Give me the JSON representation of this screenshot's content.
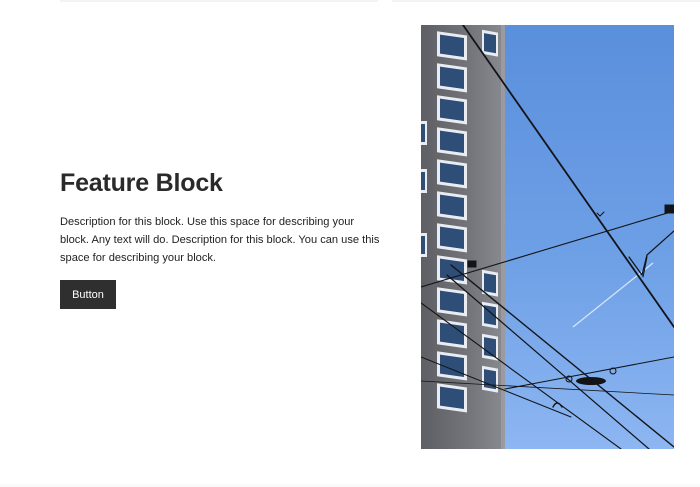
{
  "feature": {
    "title": "Feature Block",
    "description": "Description for this block. Use this space for describing your block. Any text will do. Description for this block. You can use this space for describing your block.",
    "button_label": "Button"
  },
  "image": {
    "subject": "building-and-tram-wires-photo"
  },
  "colors": {
    "sky_top": "#5a8fdc",
    "sky_bottom": "#8db6f2",
    "building": "#6c6d72",
    "window_frame": "#e9ecf0",
    "window_glass": "#2e4e78",
    "button_bg": "#2f2f2f",
    "text": "#2a2a2a"
  }
}
